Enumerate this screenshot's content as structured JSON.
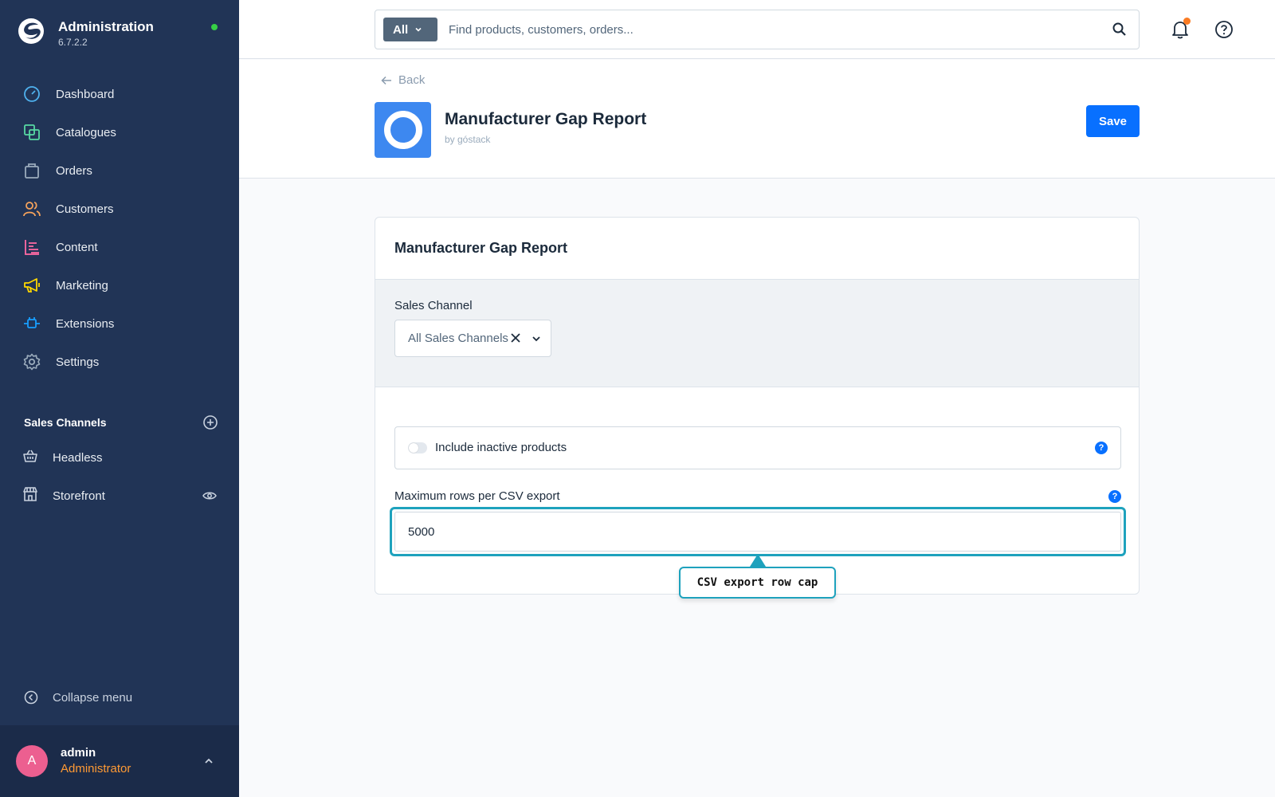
{
  "brand": {
    "title": "Administration",
    "version": "6.7.2.2"
  },
  "nav": [
    {
      "label": "Dashboard",
      "icon": "dashboard-icon",
      "color": "#4fb1ee"
    },
    {
      "label": "Catalogues",
      "icon": "catalogue-icon",
      "color": "#57d9a3"
    },
    {
      "label": "Orders",
      "icon": "orders-icon",
      "color": "#9aabbc"
    },
    {
      "label": "Customers",
      "icon": "customers-icon",
      "color": "#f6a35c"
    },
    {
      "label": "Content",
      "icon": "content-icon",
      "color": "#ff6aa4"
    },
    {
      "label": "Marketing",
      "icon": "marketing-icon",
      "color": "#ffd700"
    },
    {
      "label": "Extensions",
      "icon": "extensions-icon",
      "color": "#189eff"
    },
    {
      "label": "Settings",
      "icon": "settings-icon",
      "color": "#9aabbc"
    }
  ],
  "sales_channels": {
    "title": "Sales Channels",
    "items": [
      {
        "label": "Headless",
        "icon": "basket-icon"
      },
      {
        "label": "Storefront",
        "icon": "storefront-icon"
      }
    ]
  },
  "collapse_label": "Collapse menu",
  "user": {
    "initial": "A",
    "name": "admin",
    "role": "Administrator"
  },
  "search": {
    "type": "All",
    "placeholder": "Find products, customers, orders..."
  },
  "page": {
    "back": "Back",
    "title": "Manufacturer Gap Report",
    "by": "by góstack",
    "save": "Save"
  },
  "card": {
    "title": "Manufacturer Gap Report",
    "sales_channel_label": "Sales Channel",
    "sales_channel_value": "All Sales Channels",
    "include_inactive_label": "Include inactive products",
    "include_inactive": false,
    "max_rows_label": "Maximum rows per CSV export",
    "max_rows_value": "5000",
    "help_glyph": "?"
  },
  "callout": "CSV export row cap",
  "colors": {
    "sidebar": "#213456",
    "primary": "#0870ff",
    "highlight": "#1ea2bd",
    "online": "#37d046",
    "notification": "#fa7b23"
  }
}
